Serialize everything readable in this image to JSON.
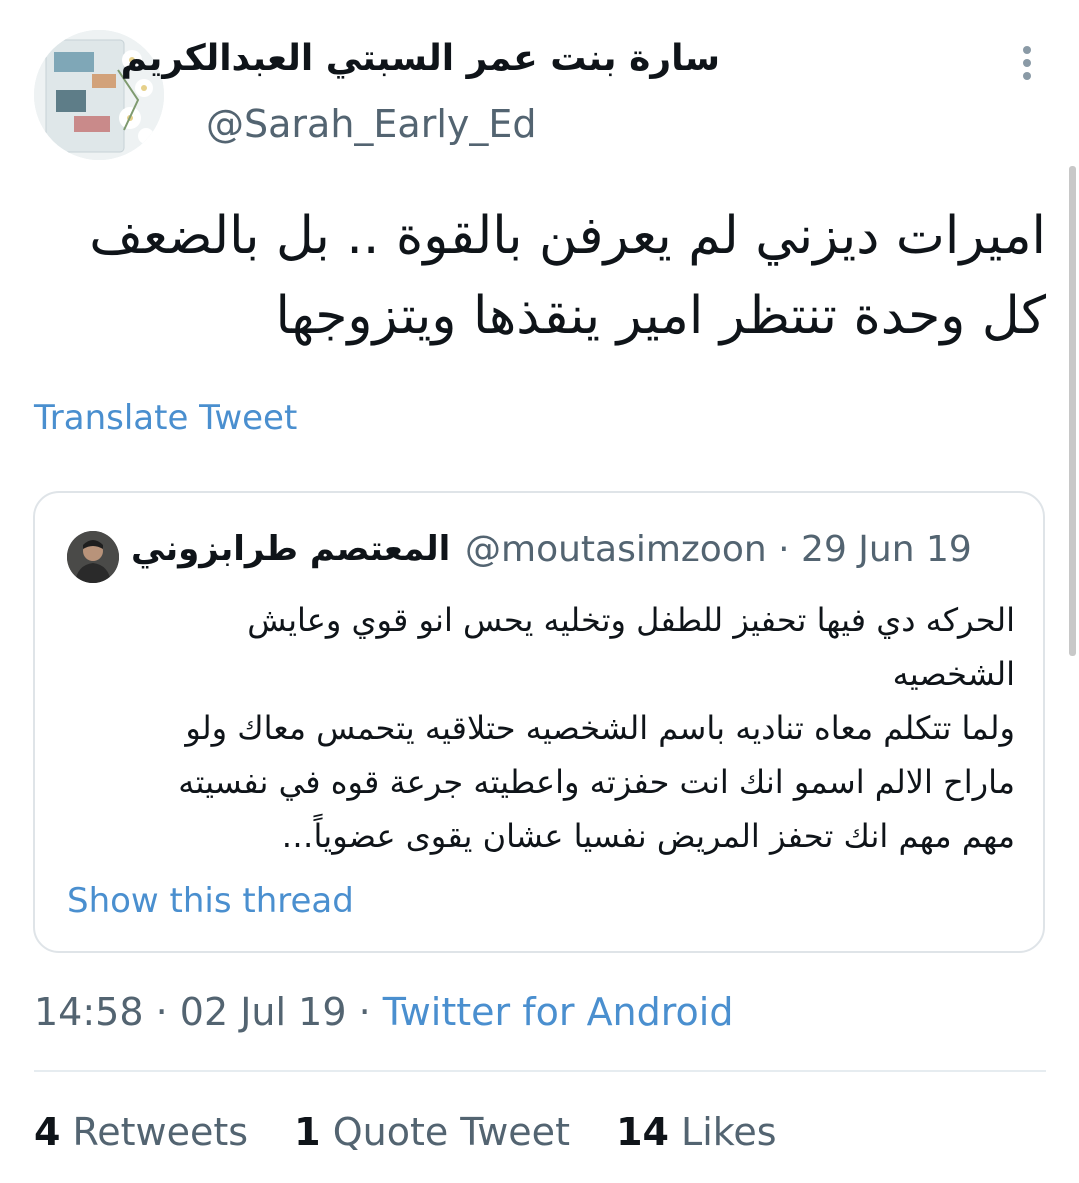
{
  "author": {
    "display_name": "سارة بنت عمر السبتي العبدالكريم",
    "handle": "@Sarah_Early_Ed",
    "avatar_icon": "book-cover-avatar-icon"
  },
  "tweet": {
    "text_lines": [
      "اميرات ديزني لم يعرفن بالقوة .. بل بالضعف",
      "كل وحدة تنتظر امير ينقذها ويتزوجها"
    ],
    "translate_label": "Translate Tweet"
  },
  "quote": {
    "display_name": "المعتصم طرابزوني",
    "handle": "@moutasimzoon",
    "separator": "·",
    "date": "29 Jun 19",
    "text_lines": [
      "الحركه دي فيها تحفيز للطفل وتخليه يحس انو قوي وعايش",
      "الشخصيه",
      "ولما تتكلم معاه تناديه باسم الشخصيه حتلاقيه يتحمس معاك ولو",
      "ماراح الالم اسمو انك انت حفزته واعطيته جرعة قوه في نفسيته",
      "مهم مهم انك تحفز المريض نفسيا عشان يقوى عضوياً…"
    ],
    "show_thread_label": "Show this thread"
  },
  "meta": {
    "time": "14:58",
    "separator": "·",
    "date": "02 Jul 19",
    "source": "Twitter for Android"
  },
  "stats": {
    "retweets_count": "4",
    "retweets_label": "Retweets",
    "quotes_count": "1",
    "quotes_label": "Quote Tweet",
    "likes_count": "14",
    "likes_label": "Likes"
  },
  "colors": {
    "link": "#4a8fcf",
    "secondary_text": "#536471",
    "primary_text": "#0f1419",
    "border": "#dfe4e8"
  }
}
